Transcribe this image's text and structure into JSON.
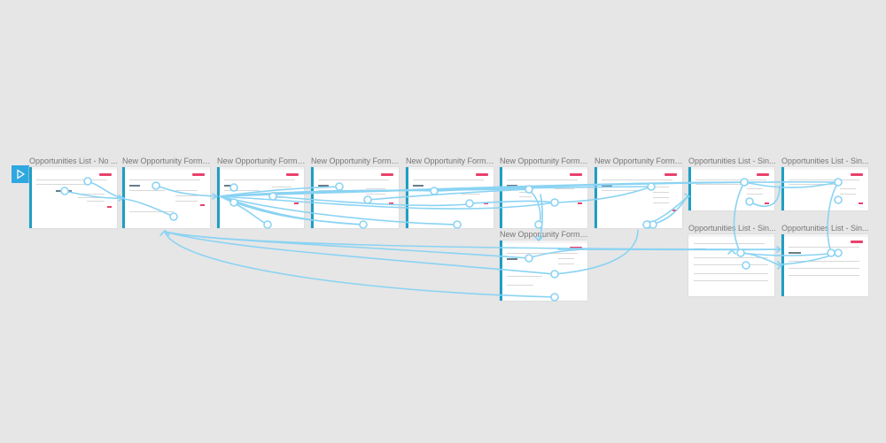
{
  "prototype_canvas": {
    "start_button_icon": "play-icon",
    "link_color": "#8ad3f3",
    "accent": "#1e9fc4",
    "artboards": [
      {
        "key": "ab1",
        "title": "Opportunities List - No ..."
      },
      {
        "key": "ab2",
        "title": "New Opportunity Form ..."
      },
      {
        "key": "ab3",
        "title": "New Opportunity Form ..."
      },
      {
        "key": "ab4",
        "title": "New Opportunity Form ..."
      },
      {
        "key": "ab5",
        "title": "New Opportunity Form ..."
      },
      {
        "key": "ab6",
        "title": "New Opportunity Form ..."
      },
      {
        "key": "ab7",
        "title": "New Opportunity Form ..."
      },
      {
        "key": "ab8",
        "title": "Opportunities List - Sin..."
      },
      {
        "key": "ab9",
        "title": "Opportunities List - Sin..."
      },
      {
        "key": "ab10",
        "title": "New Opportunity Form ..."
      },
      {
        "key": "ab11",
        "title": "Opportunities List - Sin..."
      },
      {
        "key": "ab12",
        "title": "Opportunities List - Sin..."
      }
    ]
  }
}
